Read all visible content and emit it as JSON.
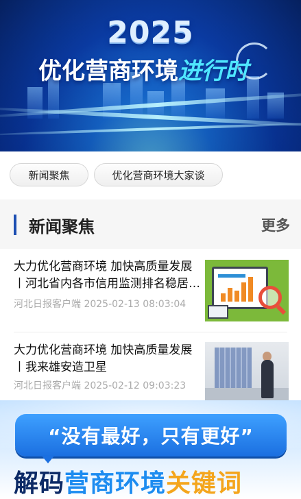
{
  "hero": {
    "year": "2025",
    "title_main": "优化营商环境",
    "title_accent": "进行时"
  },
  "tabs": [
    {
      "label": "新闻聚焦"
    },
    {
      "label": "优化营商环境大家谈"
    }
  ],
  "section": {
    "title": "新闻聚焦",
    "more_label": "更多"
  },
  "news": [
    {
      "title": "大力优化营商环境 加快高质量发展丨河北省内各市信用监测排名稳居前列",
      "source": "河北日报客户端",
      "time": "2025-02-13 08:03:04"
    },
    {
      "title": "大力优化营商环境 加快高质量发展丨我来雄安造卫星",
      "source": "河北日报客户端",
      "time": "2025-02-12 09:03:23"
    }
  ],
  "promo": {
    "quote": "“没有最好，只有更好”",
    "headline_part1": "解码",
    "headline_part2": "营商环境",
    "headline_part3": "关键词"
  },
  "colors": {
    "accent_blue": "#1d4fb2",
    "meta_gray": "#aaaaaa"
  }
}
